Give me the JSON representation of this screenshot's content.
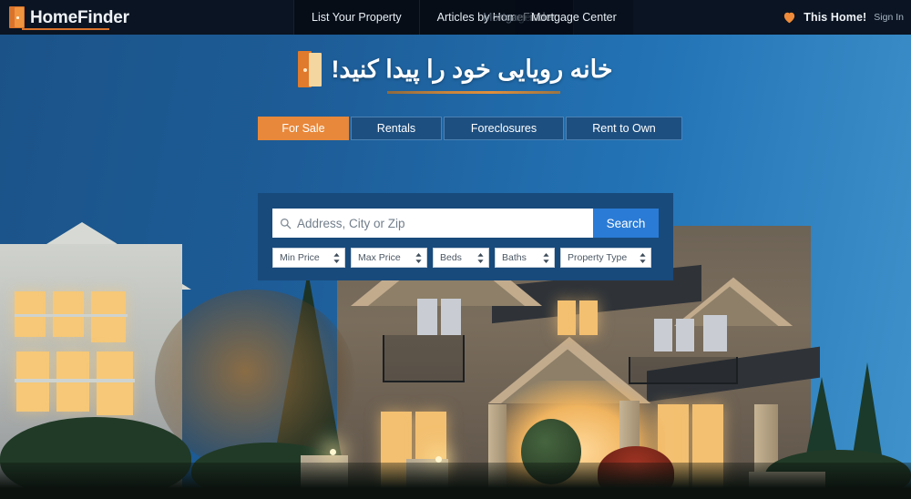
{
  "header": {
    "logo": {
      "text": "HomeFinder",
      "icon": "open-door-icon"
    },
    "nav": [
      {
        "label": "List Your Property"
      },
      {
        "label": "Articles by HomeFinder"
      },
      {
        "label": "Mortgage Center"
      }
    ],
    "nav_overlap_text": "Mortgage",
    "right": {
      "heart_icon": "heart-icon",
      "this_home_label": "This Home!",
      "sign_in_label": "Sign In"
    }
  },
  "hero": {
    "headline": "خانه رویایی خود را پیدا کنید!",
    "headline_icon": "open-door-icon",
    "tabs": [
      {
        "label": "For Sale",
        "active": true
      },
      {
        "label": "Rentals",
        "active": false
      },
      {
        "label": "Foreclosures",
        "active": false
      },
      {
        "label": "Rent to Own",
        "active": false
      }
    ],
    "search": {
      "icon": "search-icon",
      "placeholder": "Address, City or Zip",
      "value": "",
      "button_label": "Search"
    },
    "filters": [
      {
        "label": "Min Price"
      },
      {
        "label": "Max Price"
      },
      {
        "label": "Beds"
      },
      {
        "label": "Baths"
      },
      {
        "label": "Property Type"
      }
    ]
  },
  "colors": {
    "header_bg": "#0a1422",
    "accent_orange": "#e8883a",
    "panel_blue": "#184a7c",
    "search_button_blue": "#2a7bd6",
    "sky_left": "#1b5388",
    "sky_right": "#3f92cb"
  }
}
